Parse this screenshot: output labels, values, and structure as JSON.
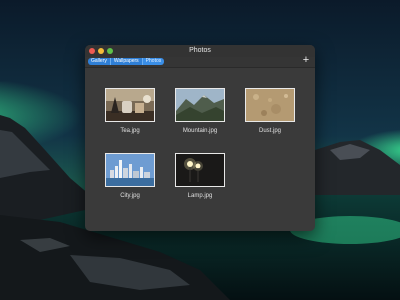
{
  "window": {
    "title": "Photos",
    "breadcrumb": [
      "Gallery",
      "Wallpapers",
      "Photos"
    ],
    "add_label": "+"
  },
  "photos": [
    {
      "name": "Tea.jpg",
      "icon": "tea-photo"
    },
    {
      "name": "Mountain.jpg",
      "icon": "mountain-photo"
    },
    {
      "name": "Dust.jpg",
      "icon": "dust-photo"
    },
    {
      "name": "City.jpg",
      "icon": "city-photo"
    },
    {
      "name": "Lamp.jpg",
      "icon": "lamp-photo"
    }
  ],
  "colors": {
    "accent": "#2f7fd6",
    "window_bg": "#3a3a3a",
    "aurora": "#2fd38a"
  }
}
